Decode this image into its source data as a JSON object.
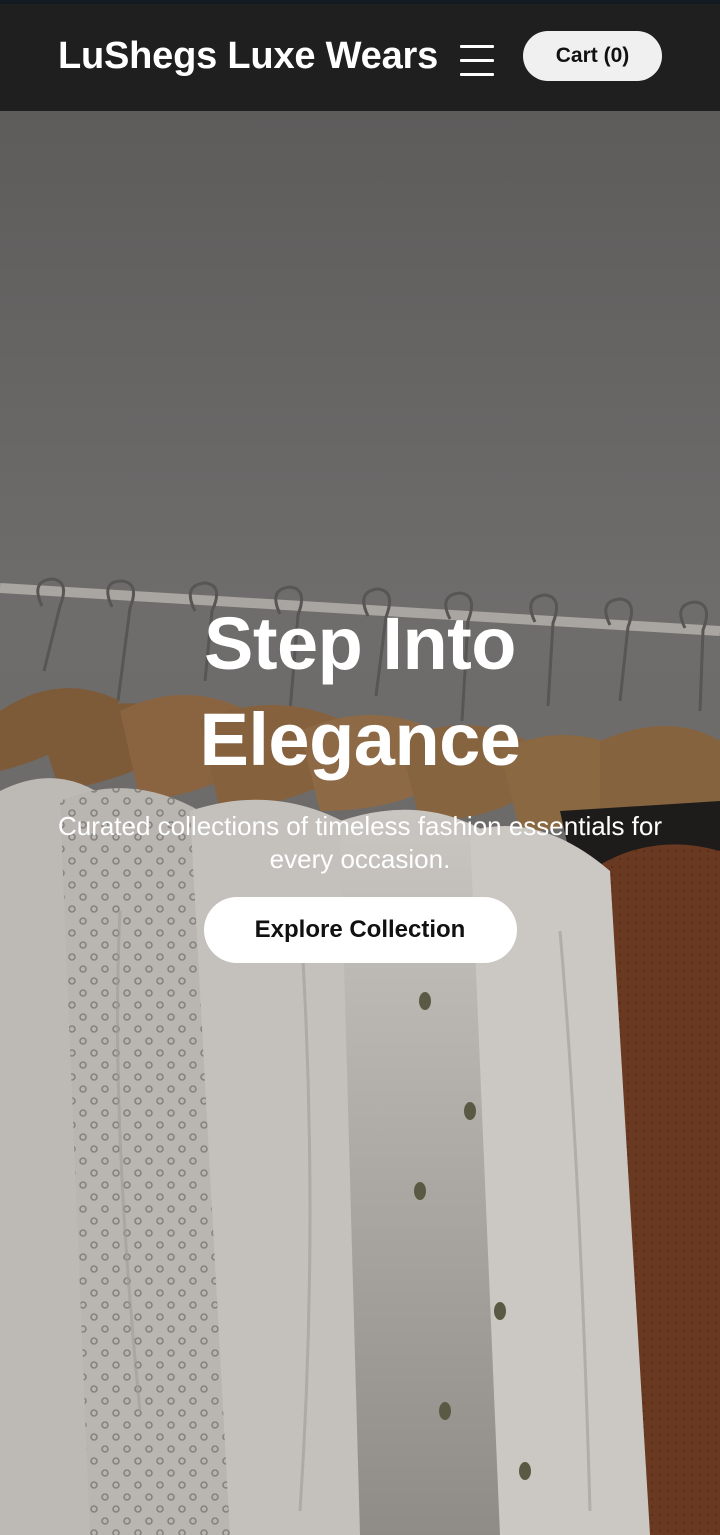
{
  "header": {
    "brand": "LuShegs Luxe Wears",
    "cart_label": "Cart (0)"
  },
  "hero": {
    "title": "Step Into Elegance",
    "subtitle": "Curated collections of timeless fashion essentials for every occasion.",
    "cta_label": "Explore Collection"
  },
  "icons": {
    "menu": "hamburger-menu-icon"
  },
  "colors": {
    "navbar_bg": "#201f1f",
    "cart_button_bg": "#f0f0f0",
    "cta_bg": "#ffffff",
    "text_light": "#ffffff",
    "text_dark": "#111111"
  }
}
